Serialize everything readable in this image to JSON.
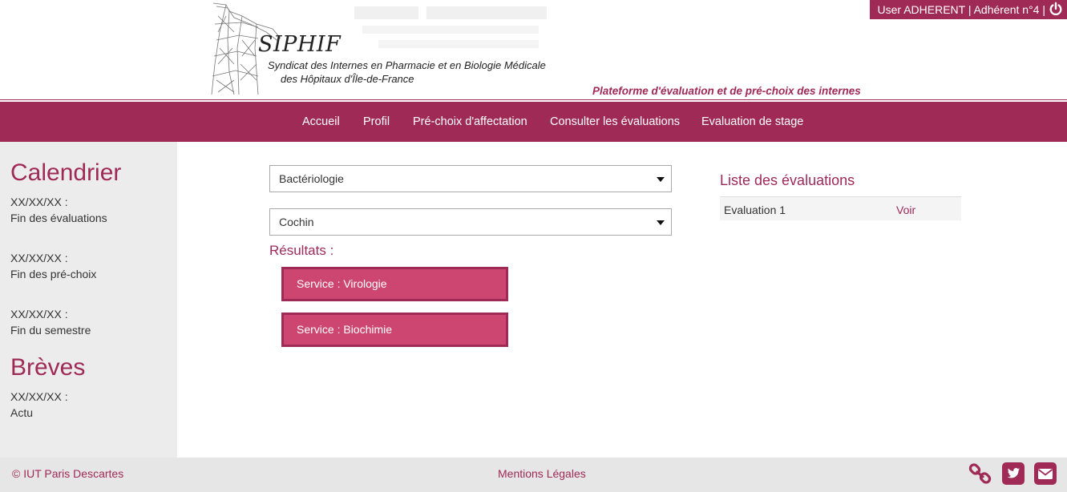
{
  "header": {
    "logo_title": "SIPHIF",
    "logo_subtitle_1": "Syndicat des Internes en Pharmacie et en Biologie Médicale",
    "logo_subtitle_2": "des Hôpitaux d'Île-de-France",
    "platform_tagline": "Plateforme d'évaluation et de pré-choix des internes",
    "user_label": "User ADHERENT | Adhérent n°4 |",
    "power_icon": "power-icon"
  },
  "nav": {
    "items": [
      {
        "label": "Accueil"
      },
      {
        "label": "Profil"
      },
      {
        "label": "Pré-choix d'affectation"
      },
      {
        "label": "Consulter les évaluations"
      },
      {
        "label": "Evaluation de stage"
      }
    ]
  },
  "sidebar": {
    "calendar_title": "Calendrier",
    "calendar": [
      {
        "date": "XX/XX/XX :",
        "text": "Fin des évaluations"
      },
      {
        "date": "XX/XX/XX :",
        "text": "Fin des pré-choix"
      },
      {
        "date": "XX/XX/XX :",
        "text": "Fin du semestre"
      }
    ],
    "news_title": "Brèves",
    "news": [
      {
        "date": "XX/XX/XX :",
        "text": "Actu"
      }
    ]
  },
  "main": {
    "specialty_select": "Bactériologie",
    "hospital_select": "Cochin",
    "results_label": "Résultats :",
    "results": [
      {
        "label": "Service : Virologie"
      },
      {
        "label": "Service : Biochimie"
      }
    ]
  },
  "evaluations": {
    "title": "Liste des évaluations",
    "rows": [
      {
        "name": "Evaluation 1",
        "action": "Voir"
      }
    ]
  },
  "footer": {
    "copyright": "© IUT Paris Descartes",
    "legal": "Mentions Légales",
    "icons": [
      "link-icon",
      "twitter-icon",
      "mail-icon"
    ]
  },
  "colors": {
    "brand": "#9e2a55",
    "button": "#cd4671",
    "sidebar_bg": "#ececec",
    "footer_bg": "#e6e6e6"
  }
}
